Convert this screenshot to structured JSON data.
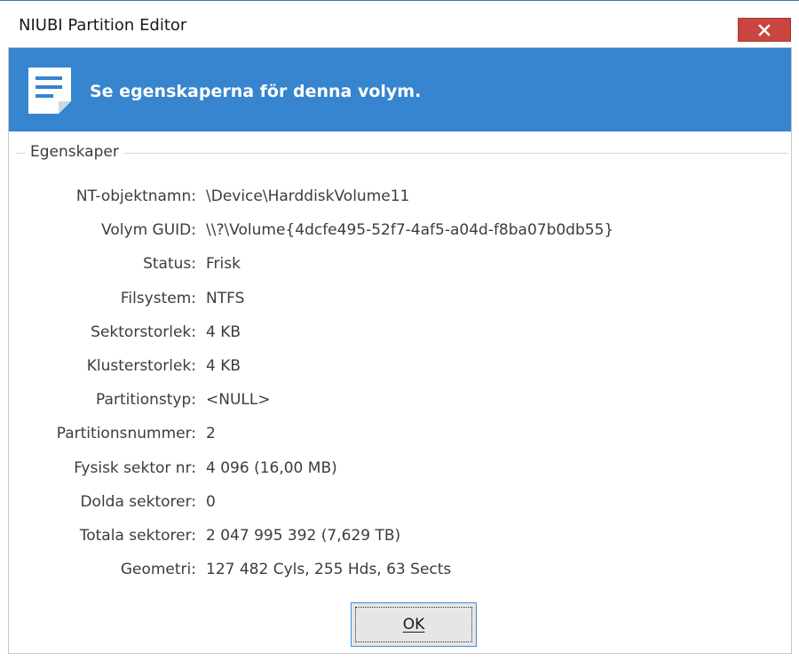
{
  "window": {
    "title": "NIUBI Partition Editor"
  },
  "banner": {
    "heading": "Se egenskaperna för denna volym.",
    "icon": "document-icon"
  },
  "group": {
    "label": "Egenskaper"
  },
  "properties": [
    {
      "label": "NT-objektnamn:",
      "value": "\\Device\\HarddiskVolume11"
    },
    {
      "label": "Volym GUID:",
      "value": "\\\\?\\Volume{4dcfe495-52f7-4af5-a04d-f8ba07b0db55}"
    },
    {
      "label": "Status:",
      "value": "Frisk"
    },
    {
      "label": "Filsystem:",
      "value": "NTFS"
    },
    {
      "label": "Sektorstorlek:",
      "value": "4 KB"
    },
    {
      "label": "Klusterstorlek:",
      "value": "4 KB"
    },
    {
      "label": "Partitionstyp:",
      "value": "<NULL>"
    },
    {
      "label": "Partitionsnummer:",
      "value": "2"
    },
    {
      "label": "Fysisk sektor nr:",
      "value": "4 096 (16,00 MB)"
    },
    {
      "label": "Dolda sektorer:",
      "value": "0"
    },
    {
      "label": "Totala sektorer:",
      "value": "2 047 995 392 (7,629 TB)"
    },
    {
      "label": "Geometri:",
      "value": "127 482 Cyls, 255 Hds, 63 Sects"
    }
  ],
  "buttons": {
    "ok_label": "OK"
  },
  "colors": {
    "banner": "#3784cf",
    "close": "#c9453f"
  }
}
